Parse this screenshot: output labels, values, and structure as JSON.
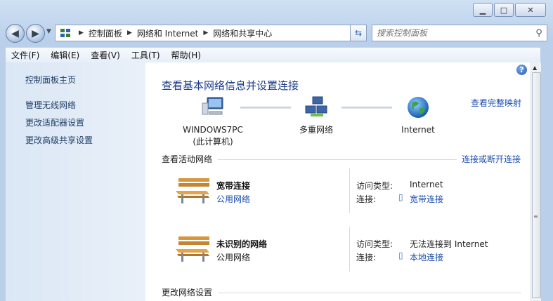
{
  "window": {
    "caption": {
      "min": "▁",
      "max": "□",
      "close": "✕"
    }
  },
  "nav": {
    "back": "◀",
    "forward": "▶",
    "breadcrumb": [
      "控制面板",
      "网络和 Internet",
      "网络和共享中心"
    ],
    "refresh_icon": "refresh-icon",
    "search_placeholder": "搜索控制面板"
  },
  "menu": [
    "文件(F)",
    "编辑(E)",
    "查看(V)",
    "工具(T)",
    "帮助(H)"
  ],
  "sidebar": {
    "items": [
      {
        "label": "控制面板主页"
      },
      {
        "label": "管理无线网络"
      },
      {
        "label": "更改适配器设置"
      },
      {
        "label": "更改高级共享设置"
      }
    ]
  },
  "main": {
    "title": "查看基本网络信息并设置连接",
    "map_link": "查看完整映射",
    "nodes": [
      {
        "label": "WINDOWS7PC",
        "sublabel": "(此计算机)",
        "icon": "computer-icon"
      },
      {
        "label": "多重网络",
        "icon": "multiple-networks-icon"
      },
      {
        "label": "Internet",
        "icon": "globe-icon"
      }
    ],
    "active_section": "查看活动网络",
    "connect_link": "连接或断开连接",
    "networks": [
      {
        "name": "宽带连接",
        "type": "公用网络",
        "type_is_link": true,
        "access_label": "访问类型:",
        "access_value": "Internet",
        "conn_label": "连接:",
        "conn_value": "宽带连接"
      },
      {
        "name": "未识别的网络",
        "type": "公用网络",
        "type_is_link": false,
        "access_label": "访问类型:",
        "access_value": "无法连接到 Internet",
        "conn_label": "连接:",
        "conn_value": "本地连接"
      }
    ],
    "change_section": "更改网络设置"
  },
  "colors": {
    "link": "#1e4fae",
    "heading": "#1a3a8a"
  }
}
